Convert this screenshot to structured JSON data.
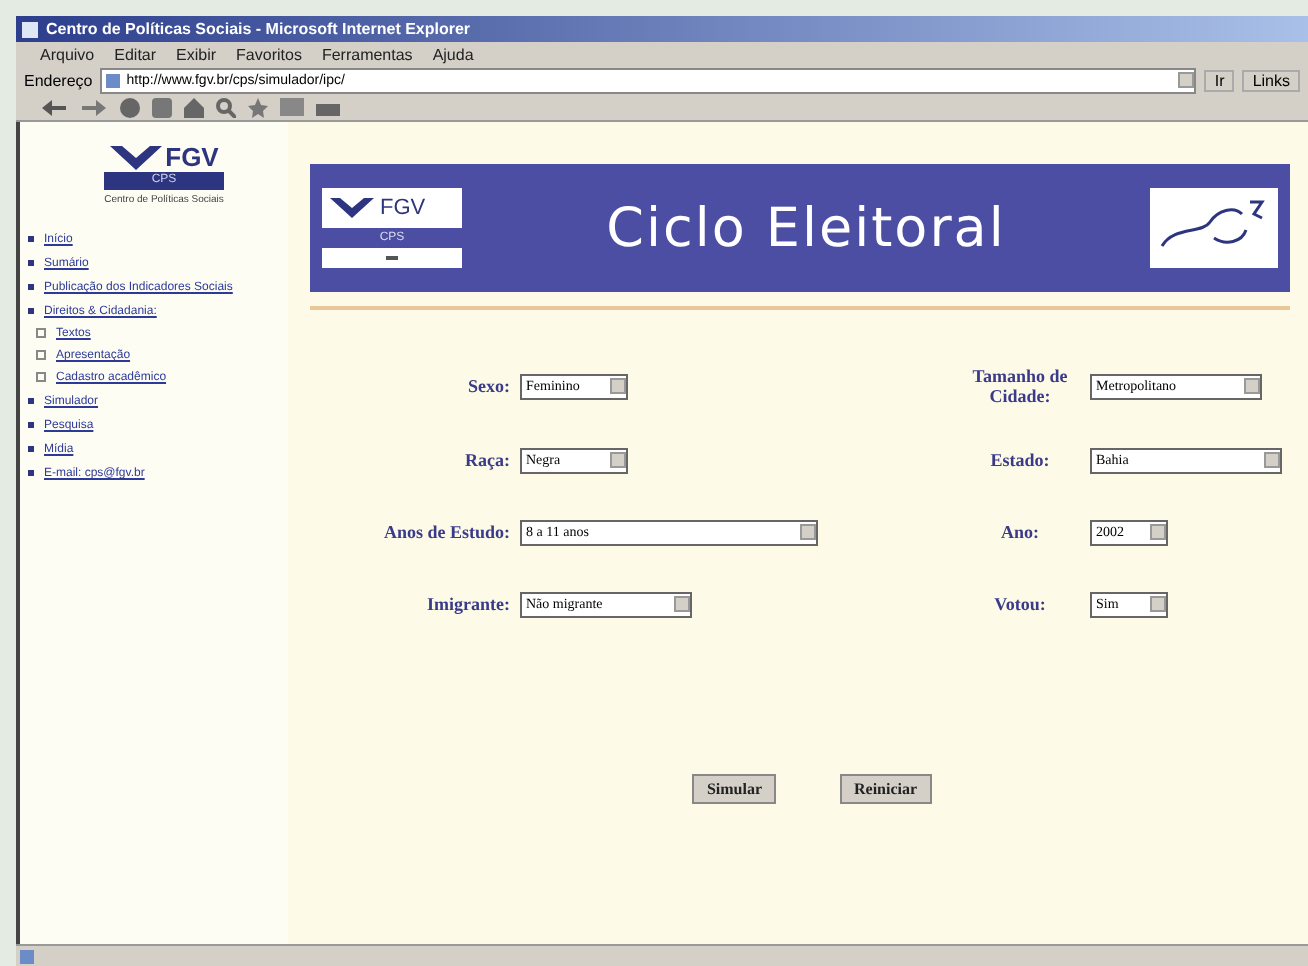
{
  "window": {
    "title": "Centro de Políticas Sociais - Microsoft Internet Explorer"
  },
  "menu": [
    "Arquivo",
    "Editar",
    "Exibir",
    "Favoritos",
    "Ferramentas",
    "Ajuda"
  ],
  "address": {
    "label": "Endereço",
    "value": "http://www.fgv.br/cps/simulador/ipc/",
    "go": "Ir",
    "links": "Links"
  },
  "sidebar": {
    "logo": {
      "text": "FGV",
      "sub": "CPS",
      "caption": "Centro de Políticas Sociais"
    },
    "items": [
      {
        "label": "Início"
      },
      {
        "label": "Sumário"
      },
      {
        "label": "Publicação dos Indicadores Sociais"
      },
      {
        "label": "Direitos & Cidadania:",
        "children": [
          {
            "label": "Textos"
          },
          {
            "label": "Apresentação"
          },
          {
            "label": "Cadastro acadêmico"
          }
        ]
      },
      {
        "label": "Simulador"
      },
      {
        "label": "Pesquisa"
      },
      {
        "label": "Mídia"
      },
      {
        "label": "E-mail: cps@fgv.br"
      }
    ]
  },
  "banner": {
    "title": "Ciclo Eleitoral",
    "logo_text": "FGV",
    "logo_sub": "CPS"
  },
  "form": {
    "rows": [
      {
        "left": {
          "label": "Sexo:",
          "value": "Feminino"
        },
        "right": {
          "label": "Tamanho de Cidade:",
          "value": "Metropolitano"
        }
      },
      {
        "left": {
          "label": "Raça:",
          "value": "Negra"
        },
        "right": {
          "label": "Estado:",
          "value": "Bahia"
        }
      },
      {
        "left": {
          "label": "Anos de Estudo:",
          "value": "8 a 11 anos"
        },
        "right": {
          "label": "Ano:",
          "value": "2002"
        }
      },
      {
        "left": {
          "label": "Imigrante:",
          "value": "Não migrante"
        },
        "right": {
          "label": "Votou:",
          "value": "Sim"
        }
      }
    ]
  },
  "buttons": [
    "Simular",
    "Reiniciar"
  ]
}
